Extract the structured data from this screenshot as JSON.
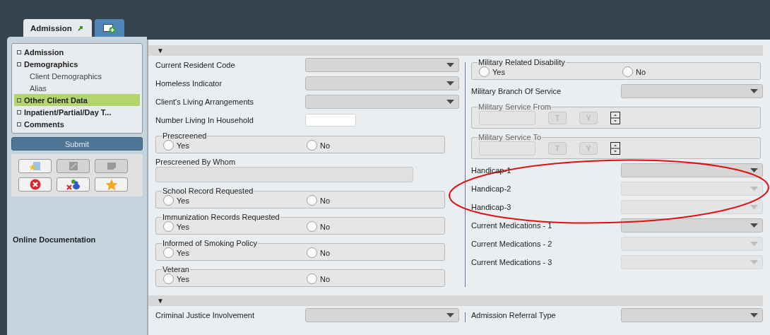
{
  "tabs": [
    {
      "kind": "text",
      "label": "Admission",
      "selected": true
    },
    {
      "kind": "add",
      "selected": false
    }
  ],
  "nav": [
    {
      "label": "Admission",
      "selected": false
    },
    {
      "label": "Demographics",
      "selected": false,
      "children": [
        {
          "label": "Client Demographics",
          "selected": false
        },
        {
          "label": "Alias",
          "selected": false
        }
      ]
    },
    {
      "label": "Other Client Data",
      "selected": true
    },
    {
      "label": "Inpatient/Partial/Day T...",
      "selected": false
    },
    {
      "label": "Comments",
      "selected": false
    }
  ],
  "submit": "Submit",
  "tools": [
    {
      "kind": "folder-star",
      "disabled": false
    },
    {
      "kind": "edit",
      "disabled": true
    },
    {
      "kind": "note",
      "disabled": true
    },
    {
      "kind": "delete",
      "disabled": false
    },
    {
      "kind": "people-remove",
      "disabled": false
    },
    {
      "kind": "star",
      "disabled": false
    }
  ],
  "online_documentation": "Online Documentation",
  "sections": [
    {
      "toggle": "▼",
      "left": [
        {
          "kind": "select",
          "label": "Current Resident Code",
          "disabled": false
        },
        {
          "kind": "select",
          "label": "Homeless Indicator",
          "disabled": false
        },
        {
          "kind": "select",
          "label": "Client's Living Arrangements",
          "disabled": false
        },
        {
          "kind": "text",
          "label": "Number Living In Household"
        },
        {
          "kind": "radio",
          "label": "Prescreened",
          "options": [
            {
              "label": "Yes",
              "selected": false
            },
            {
              "label": "No",
              "selected": false
            }
          ]
        },
        {
          "kind": "wide",
          "label": "Prescreened By Whom"
        },
        {
          "kind": "radio",
          "label": "School Record Requested",
          "options": [
            {
              "label": "Yes",
              "selected": false
            },
            {
              "label": "No",
              "selected": false
            }
          ]
        },
        {
          "kind": "radio",
          "label": "Immunization Records Requested",
          "options": [
            {
              "label": "Yes",
              "selected": false
            },
            {
              "label": "No",
              "selected": false
            }
          ]
        },
        {
          "kind": "radio",
          "label": "Informed of Smoking Policy",
          "options": [
            {
              "label": "Yes",
              "selected": false
            },
            {
              "label": "No",
              "selected": false
            }
          ]
        },
        {
          "kind": "radio",
          "label": "Veteran",
          "options": [
            {
              "label": "Yes",
              "selected": false
            },
            {
              "label": "No",
              "selected": false
            }
          ]
        }
      ],
      "right": [
        {
          "kind": "radio",
          "label": "Military Related Disability",
          "options": [
            {
              "label": "Yes",
              "selected": false
            },
            {
              "label": "No",
              "selected": false
            }
          ]
        },
        {
          "kind": "select",
          "label": "Military Branch Of Service",
          "disabled": false
        },
        {
          "kind": "date",
          "label": "Military Service From",
          "today": "T",
          "yesterday": "Y"
        },
        {
          "kind": "date",
          "label": "Military Service To",
          "today": "T",
          "yesterday": "Y"
        },
        {
          "kind": "select",
          "label": "Handicap-1",
          "disabled": false
        },
        {
          "kind": "select",
          "label": "Handicap-2",
          "disabled": true
        },
        {
          "kind": "select",
          "label": "Handicap-3",
          "disabled": true
        },
        {
          "kind": "select",
          "label": "Current Medications - 1",
          "disabled": false
        },
        {
          "kind": "select",
          "label": "Current Medications - 2",
          "disabled": true
        },
        {
          "kind": "select",
          "label": "Current Medications - 3",
          "disabled": true
        }
      ]
    },
    {
      "toggle": "▼",
      "left": [
        {
          "kind": "select",
          "label": "Criminal Justice Involvement",
          "disabled": false
        }
      ],
      "right": [
        {
          "kind": "select",
          "label": "Admission Referral Type",
          "disabled": false
        }
      ]
    }
  ],
  "annotation": {
    "kind": "ellipse"
  }
}
